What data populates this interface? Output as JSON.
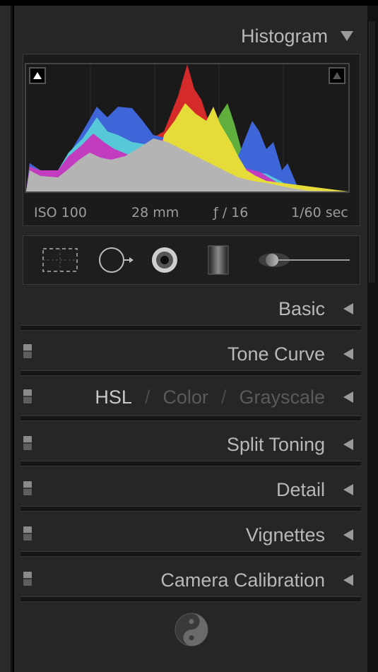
{
  "histogram": {
    "title": "Histogram",
    "exif": {
      "iso": "ISO 100",
      "focal": "28 mm",
      "aperture": "ƒ / 16",
      "shutter": "1/60 sec"
    }
  },
  "tools": [
    {
      "name": "crop-overlay-tool-icon"
    },
    {
      "name": "spot-removal-tool-icon"
    },
    {
      "name": "red-eye-tool-icon"
    },
    {
      "name": "graduated-filter-tool-icon"
    },
    {
      "name": "adjustment-brush-tool-icon"
    }
  ],
  "panels": {
    "basic": "Basic",
    "tone_curve": "Tone Curve",
    "hsl": {
      "hsl": "HSL",
      "sep": "/",
      "color": "Color",
      "grayscale": "Grayscale"
    },
    "split_toning": "Split Toning",
    "detail": "Detail",
    "vignettes": "Vignettes",
    "camera_calibration": "Camera Calibration"
  },
  "footer_icon": "yin-yang-icon",
  "colors": {
    "panel_bg": "#262626",
    "text": "#b8b8b8",
    "red": "#d42a2a",
    "yellow": "#e5dc3a",
    "blue": "#3f66d8",
    "green": "#5fae3e",
    "cyan": "#56c8d8",
    "magenta": "#c23cbf"
  }
}
